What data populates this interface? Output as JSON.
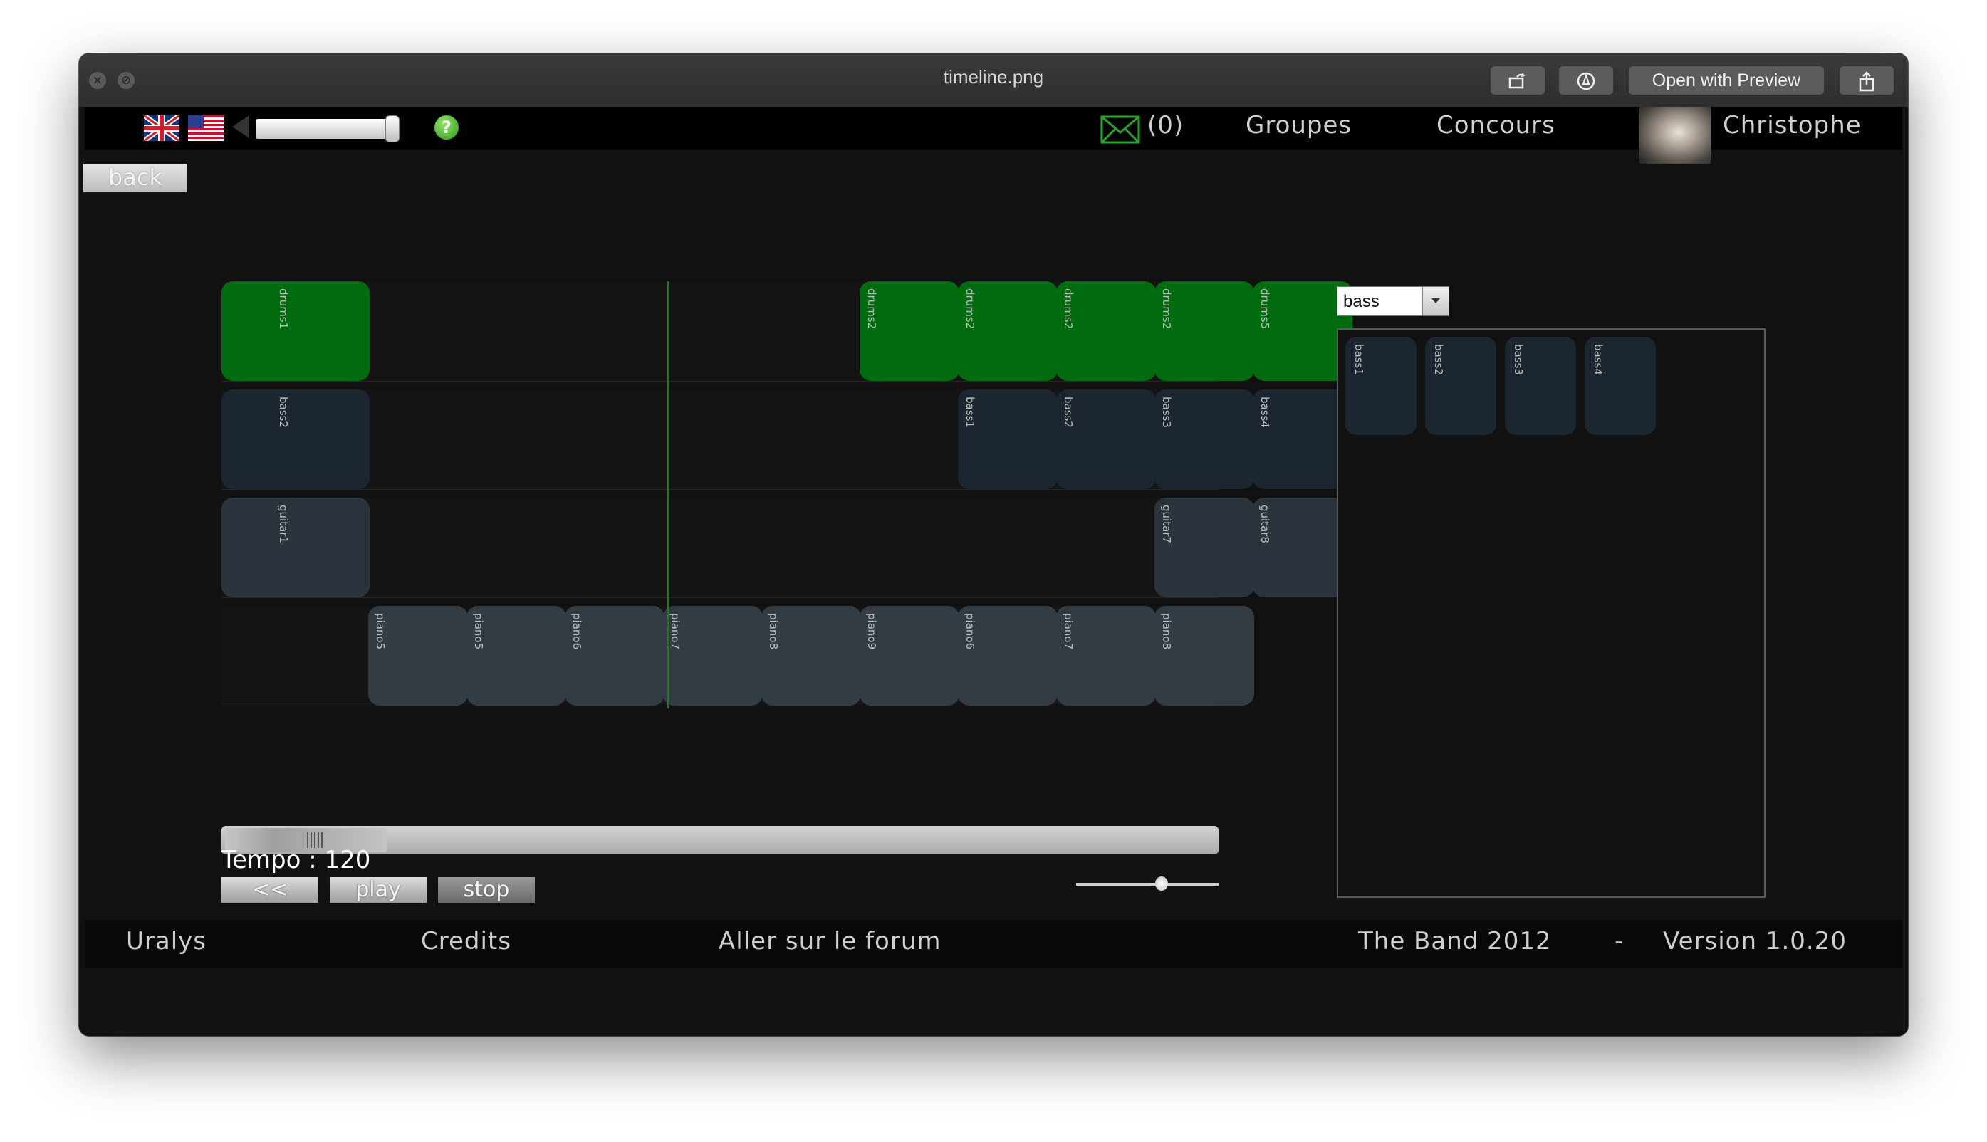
{
  "window": {
    "title": "timeline.png"
  },
  "toolbar": {
    "open_with_preview_label": "Open with Preview"
  },
  "topbar": {
    "messages_count": "(0)",
    "groupes_label": "Groupes",
    "concours_label": "Concours",
    "user_name": "Christophe",
    "help_glyph": "?"
  },
  "back_label": "back",
  "tracks": [
    {
      "name": "drums",
      "color": "#006b0f",
      "clips": [
        {
          "label": "drums1"
        },
        {
          "label": "drums2"
        },
        {
          "label": "drums2"
        },
        {
          "label": "drums2"
        },
        {
          "label": "drums2"
        },
        {
          "label": "drums5"
        }
      ]
    },
    {
      "name": "bass",
      "color": "#1c2630",
      "clips": [
        {
          "label": "bass2"
        },
        {
          "label": "bass1"
        },
        {
          "label": "bass2"
        },
        {
          "label": "bass3"
        },
        {
          "label": "bass4"
        }
      ]
    },
    {
      "name": "guitar",
      "color": "#2b343c",
      "clips": [
        {
          "label": "guitar1"
        },
        {
          "label": "guitar7"
        },
        {
          "label": "guitar8"
        }
      ]
    },
    {
      "name": "piano",
      "color": "#333b43",
      "clips": [
        {
          "label": "piano5"
        },
        {
          "label": "piano5"
        },
        {
          "label": "piano6"
        },
        {
          "label": "piano7"
        },
        {
          "label": "piano8"
        },
        {
          "label": "piano9"
        },
        {
          "label": "piano6"
        },
        {
          "label": "piano7"
        },
        {
          "label": "piano8"
        }
      ]
    }
  ],
  "transport": {
    "tempo_label": "Tempo : 120",
    "rewind_label": "<<",
    "play_label": "play",
    "stop_label": "stop",
    "position_fraction": 0.15,
    "volume_fraction": 0.6
  },
  "library": {
    "selected_instrument": "bass",
    "clips": [
      {
        "label": "bass1"
      },
      {
        "label": "bass2"
      },
      {
        "label": "bass3"
      },
      {
        "label": "bass4"
      }
    ]
  },
  "footer": {
    "uralys": "Uralys",
    "credits": "Credits",
    "forum": "Aller sur le forum",
    "band": "The Band 2012",
    "separator": "-",
    "version": "Version 1.0.20"
  },
  "colors": {
    "accent_green": "#006b0f",
    "playhead": "#1f7a1f"
  },
  "icons": [
    "close-icon",
    "minimize-icon",
    "rotate-icon",
    "markup-icon",
    "share-icon",
    "uk-flag-icon",
    "us-flag-icon",
    "help-icon",
    "envelope-icon"
  ]
}
